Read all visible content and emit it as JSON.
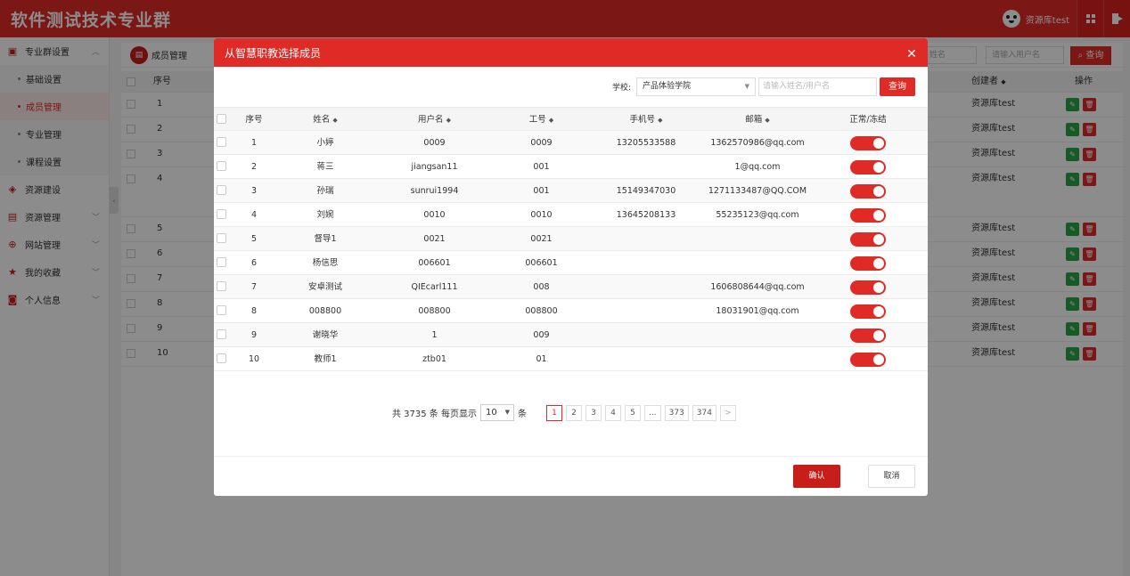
{
  "app": {
    "title": "软件测试技术专业群",
    "username": "资源库test"
  },
  "sidebar": {
    "items": [
      {
        "label": "专业群设置",
        "expanded": true
      },
      {
        "label": "资源建设"
      },
      {
        "label": "资源管理"
      },
      {
        "label": "网站管理"
      },
      {
        "label": "我的收藏"
      },
      {
        "label": "个人信息"
      }
    ],
    "sub_items": [
      {
        "label": "基础设置"
      },
      {
        "label": "成员管理",
        "active": true
      },
      {
        "label": "专业管理"
      },
      {
        "label": "课程设置"
      }
    ]
  },
  "main": {
    "tab_title": "成员管理",
    "search_name_placeholder": "姓名",
    "search_user_placeholder": "请输入用户名",
    "query_label": "查询",
    "columns": {
      "index": "序号",
      "creator": "创建者",
      "ops": "操作"
    },
    "rows": [
      {
        "index": "1",
        "creator": "资源库test"
      },
      {
        "index": "2",
        "creator": "资源库test"
      },
      {
        "index": "3",
        "creator": "资源库test"
      },
      {
        "index": "4",
        "creator": "资源库test"
      },
      {
        "index": "5",
        "creator": "资源库test"
      },
      {
        "index": "6",
        "creator": "资源库test"
      },
      {
        "index": "7",
        "creator": "资源库test"
      },
      {
        "index": "8",
        "creator": "资源库test"
      },
      {
        "index": "9",
        "creator": "资源库test"
      },
      {
        "index": "10",
        "creator": "资源库test"
      }
    ]
  },
  "modal": {
    "title": "从智慧职教选择成员",
    "filter": {
      "school_label": "学校:",
      "school_value": "产品体验学院",
      "name_placeholder": "请输入姓名/用户名",
      "query_label": "查询"
    },
    "columns": {
      "index": "序号",
      "name": "姓名",
      "username": "用户名",
      "job_no": "工号",
      "phone": "手机号",
      "email": "邮箱",
      "status": "正常/冻结"
    },
    "rows": [
      {
        "index": "1",
        "name": "小婷",
        "username": "0009",
        "job_no": "0009",
        "phone": "13205533588",
        "email": "1362570986@qq.com"
      },
      {
        "index": "2",
        "name": "蒋三",
        "username": "jiangsan11",
        "job_no": "001",
        "phone": "",
        "email": "1@qq.com"
      },
      {
        "index": "3",
        "name": "孙瑞",
        "username": "sunrui1994",
        "job_no": "001",
        "phone": "15149347030",
        "email": "1271133487@QQ.COM"
      },
      {
        "index": "4",
        "name": "刘婉",
        "username": "0010",
        "job_no": "0010",
        "phone": "13645208133",
        "email": "55235123@qq.com"
      },
      {
        "index": "5",
        "name": "督导1",
        "username": "0021",
        "job_no": "0021",
        "phone": "",
        "email": ""
      },
      {
        "index": "6",
        "name": "杨信思",
        "username": "006601",
        "job_no": "006601",
        "phone": "",
        "email": ""
      },
      {
        "index": "7",
        "name": "安卓测试",
        "username": "QIEcarl111",
        "job_no": "008",
        "phone": "",
        "email": "1606808644@qq.com"
      },
      {
        "index": "8",
        "name": "008800",
        "username": "008800",
        "job_no": "008800",
        "phone": "",
        "email": "18031901@qq.com"
      },
      {
        "index": "9",
        "name": "谢晓华",
        "username": "1",
        "job_no": "009",
        "phone": "",
        "email": ""
      },
      {
        "index": "10",
        "name": "教师1",
        "username": "ztb01",
        "job_no": "01",
        "phone": "",
        "email": ""
      }
    ],
    "pager": {
      "total_text": "共 3735 条 每页显示",
      "page_size": "10",
      "unit": "条",
      "pages": [
        "1",
        "2",
        "3",
        "4",
        "5",
        "...",
        "373",
        "374",
        ">"
      ],
      "current_page": "1"
    },
    "confirm_label": "确认",
    "cancel_label": "取消"
  },
  "colors": {
    "brand": "#e02a25",
    "success": "#28a745"
  }
}
